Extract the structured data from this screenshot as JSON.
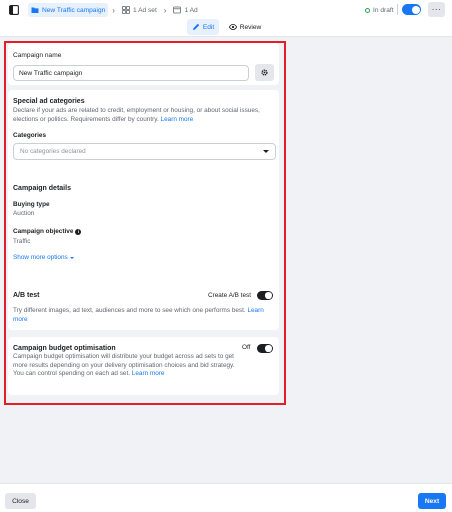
{
  "topbar": {
    "breadcrumbs": [
      {
        "label": "New Traffic campaign",
        "icon": "folder-icon",
        "active": true
      },
      {
        "label": "1 Ad set",
        "icon": "grid-icon",
        "active": false
      },
      {
        "label": "1 Ad",
        "icon": "ad-icon",
        "active": false
      }
    ],
    "status": "In draft",
    "status_color": "#31a24c",
    "toggle_on": true,
    "more_label": "···"
  },
  "modes": {
    "edit_label": "Edit",
    "review_label": "Review"
  },
  "campaign_name": {
    "label": "Campaign name",
    "value": "New Traffic campaign"
  },
  "special_ad": {
    "title": "Special ad categories",
    "description": "Declare if your ads are related to credit, employment or housing, or about social issues, elections or politics. Requirements differ by country.",
    "learn_more": "Learn more",
    "categories_label": "Categories",
    "categories_placeholder": "No categories declared"
  },
  "campaign_details": {
    "title": "Campaign details",
    "buying_type_label": "Buying type",
    "buying_type_value": "Auction",
    "objective_label": "Campaign objective",
    "objective_value": "Traffic",
    "show_more": "Show more options"
  },
  "ab_test": {
    "title": "A/B test",
    "create_label": "Create A/B test",
    "toggle_on": false,
    "description": "Try different images, ad text, audiences and more to see which one performs best.",
    "learn_more": "Learn more"
  },
  "budget": {
    "title": "Campaign budget optimisation",
    "status": "Off",
    "toggle_on": false,
    "description": "Campaign budget optimisation will distribute your budget across ad sets to get more results depending on your delivery optimisation choices and bid strategy. You can control spending on each ad set.",
    "learn_more": "Learn more"
  },
  "footer": {
    "close_label": "Close",
    "next_label": "Next"
  },
  "colors": {
    "accent": "#1877f2",
    "highlight": "#e41e26"
  }
}
